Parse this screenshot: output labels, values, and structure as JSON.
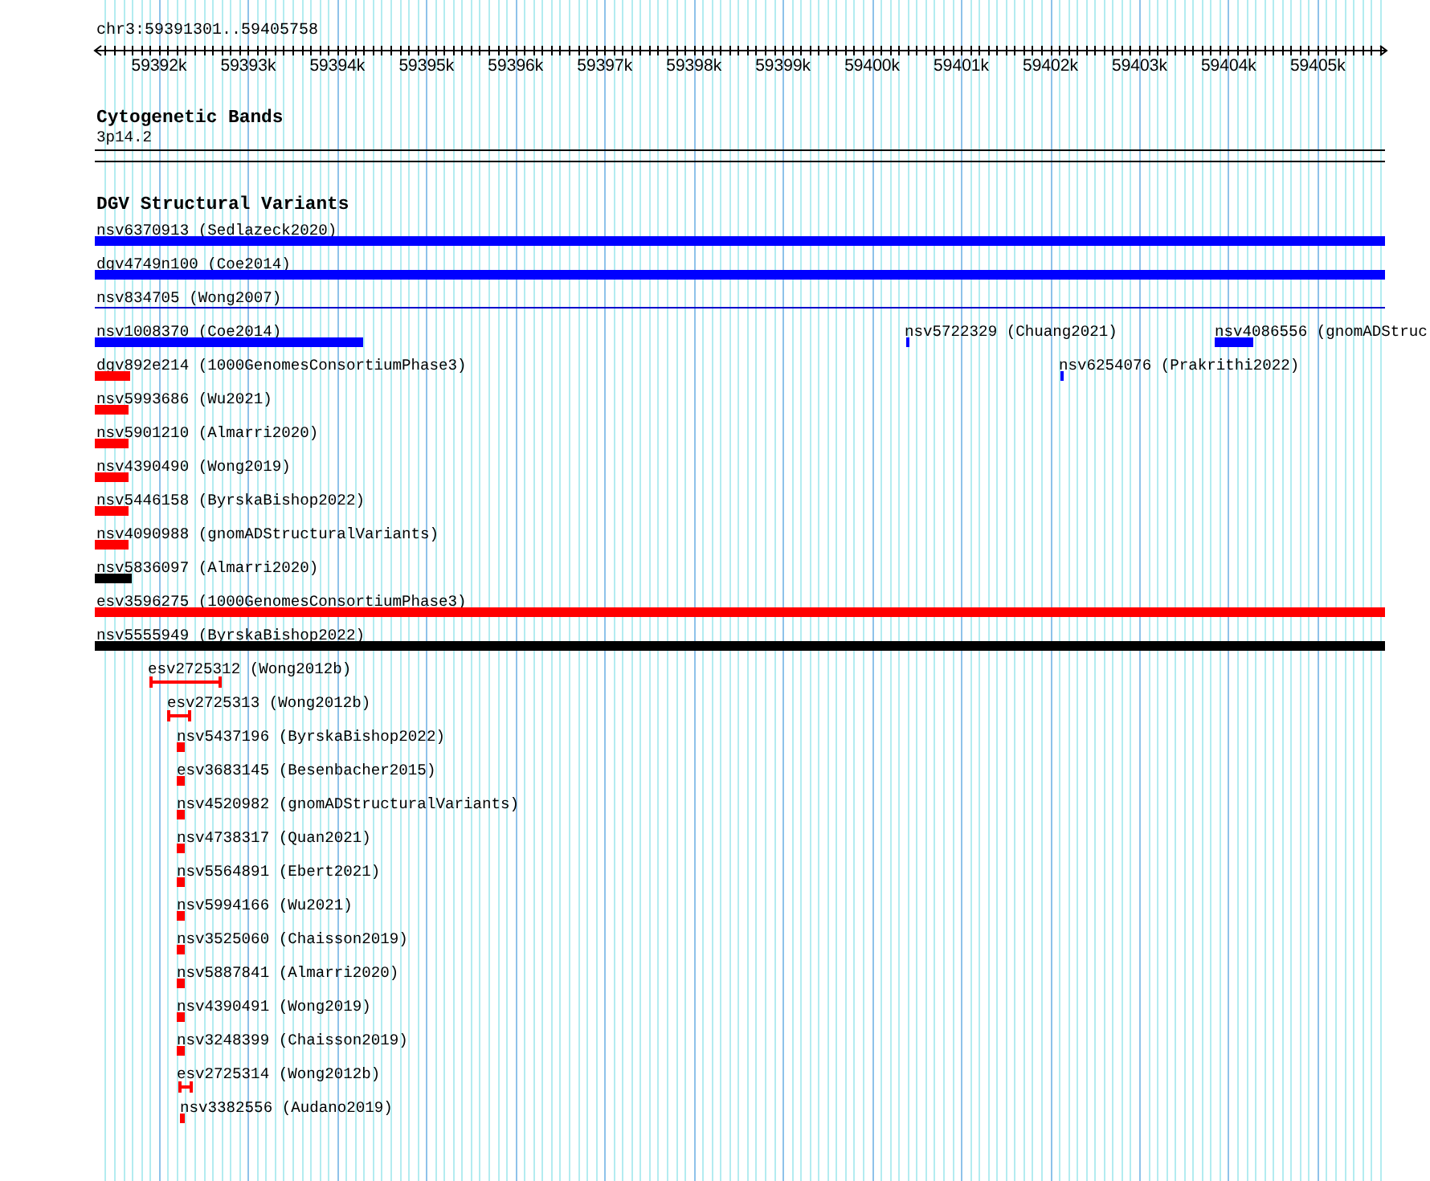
{
  "ruler": {
    "location": "chr3:59391301..59405758",
    "ticks": [
      "59392k",
      "59393k",
      "59394k",
      "59395k",
      "59396k",
      "59397k",
      "59398k",
      "59399k",
      "59400k",
      "59401k",
      "59402k",
      "59403k",
      "59404k",
      "59405k"
    ]
  },
  "tracks": [
    {
      "title": "Cytogenetic Bands",
      "features": [
        {
          "label": "3p14.2",
          "kind": "band"
        }
      ]
    },
    {
      "title": "DGV Structural Variants",
      "features": [
        {
          "label": "nsv6370913 (Sedlazeck2020)",
          "kind": "bar",
          "color": "#0000ff"
        },
        {
          "label": "dgv4749n100 (Coe2014)",
          "kind": "bar",
          "color": "#0000ff"
        },
        {
          "label": "nsv834705 (Wong2007)",
          "kind": "line",
          "color": "#0000cc"
        },
        {
          "label": "nsv1008370 (Coe2014)",
          "kind": "bar",
          "color": "#0000ff"
        },
        {
          "label": "nsv5722329 (Chuang2021)",
          "kind": "bar",
          "color": "#0000ff"
        },
        {
          "label": "nsv4086556 (gnomADStruc",
          "kind": "bar",
          "color": "#0000ff"
        },
        {
          "label": "dgv892e214 (1000GenomesConsortiumPhase3)",
          "kind": "bar",
          "color": "#ff0000"
        },
        {
          "label": "nsv6254076 (Prakrithi2022)",
          "kind": "bar",
          "color": "#0000ff"
        },
        {
          "label": "nsv5993686 (Wu2021)",
          "kind": "bar",
          "color": "#ff0000"
        },
        {
          "label": "nsv5901210 (Almarri2020)",
          "kind": "bar",
          "color": "#ff0000"
        },
        {
          "label": "nsv4390490 (Wong2019)",
          "kind": "bar",
          "color": "#ff0000"
        },
        {
          "label": "nsv5446158 (ByrskaBishop2022)",
          "kind": "bar",
          "color": "#ff0000"
        },
        {
          "label": "nsv4090988 (gnomADStructuralVariants)",
          "kind": "bar",
          "color": "#ff0000"
        },
        {
          "label": "nsv5836097 (Almarri2020)",
          "kind": "bar",
          "color": "#000000"
        },
        {
          "label": "esv3596275 (1000GenomesConsortiumPhase3)",
          "kind": "bar",
          "color": "#ff0000"
        },
        {
          "label": "nsv5555949 (ByrskaBishop2022)",
          "kind": "bar",
          "color": "#000000"
        },
        {
          "label": "esv2725312 (Wong2012b)",
          "kind": "span",
          "color": "#ff0000"
        },
        {
          "label": "esv2725313 (Wong2012b)",
          "kind": "span",
          "color": "#ff0000"
        },
        {
          "label": "nsv5437196 (ByrskaBishop2022)",
          "kind": "bar",
          "color": "#ff0000"
        },
        {
          "label": "esv3683145 (Besenbacher2015)",
          "kind": "bar",
          "color": "#ff0000"
        },
        {
          "label": "nsv4520982 (gnomADStructuralVariants)",
          "kind": "bar",
          "color": "#ff0000"
        },
        {
          "label": "nsv4738317 (Quan2021)",
          "kind": "bar",
          "color": "#ff0000"
        },
        {
          "label": "nsv5564891 (Ebert2021)",
          "kind": "bar",
          "color": "#ff0000"
        },
        {
          "label": "nsv5994166 (Wu2021)",
          "kind": "bar",
          "color": "#ff0000"
        },
        {
          "label": "nsv3525060 (Chaisson2019)",
          "kind": "bar",
          "color": "#ff0000"
        },
        {
          "label": "nsv5887841 (Almarri2020)",
          "kind": "bar",
          "color": "#ff0000"
        },
        {
          "label": "nsv4390491 (Wong2019)",
          "kind": "bar",
          "color": "#ff0000"
        },
        {
          "label": "nsv3248399 (Chaisson2019)",
          "kind": "bar",
          "color": "#ff0000"
        },
        {
          "label": "esv2725314 (Wong2012b)",
          "kind": "span",
          "color": "#ff0000"
        },
        {
          "label": "nsv3382556 (Audano2019)",
          "kind": "bar",
          "color": "#ff0000"
        }
      ]
    }
  ]
}
